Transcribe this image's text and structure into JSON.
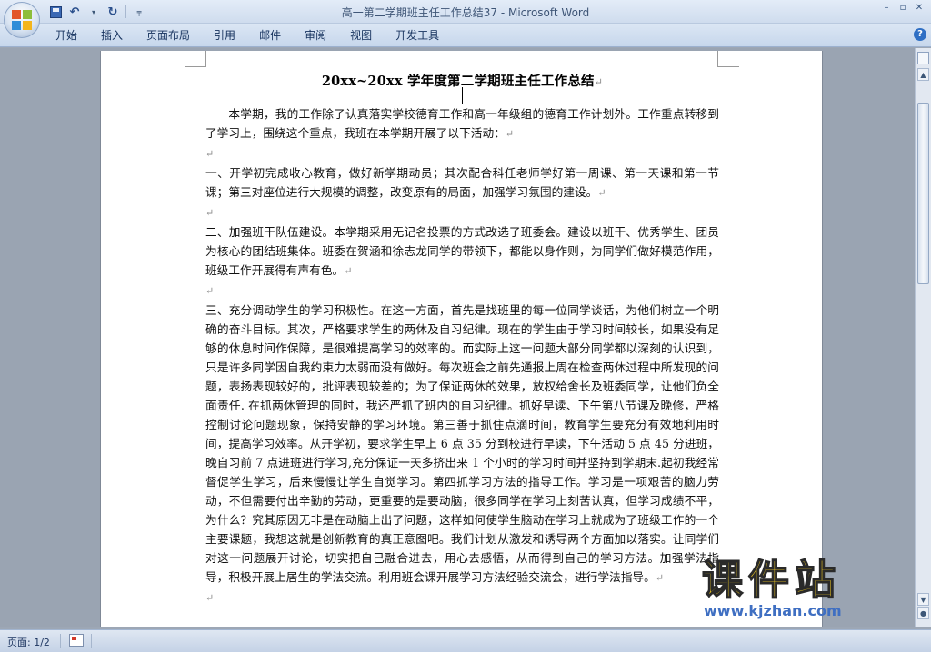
{
  "window": {
    "doc_name": "高一第二学期班主任工作总结37",
    "separator": " - ",
    "app_name": "Microsoft Word"
  },
  "quick_access": {
    "undo_glyph": "↶",
    "redo_glyph": "↻",
    "dropdown_glyph": "▾",
    "customize_glyph": "╤"
  },
  "window_controls": {
    "minimize": "–",
    "restore": "▫",
    "close": "✕"
  },
  "ribbon": {
    "tabs": [
      "开始",
      "插入",
      "页面布局",
      "引用",
      "邮件",
      "审阅",
      "视图",
      "开发工具"
    ],
    "help": "?"
  },
  "document": {
    "title": "20xx~20xx 学年度第二学期班主任工作总结",
    "paragraph_mark": "↵",
    "paragraphs": [
      "本学期，我的工作除了认真落实学校德育工作和高一年级组的德育工作计划外。工作重点转移到了学习上，围绕这个重点，我班在本学期开展了以下活动：",
      "",
      "一、开学初完成收心教育，做好新学期动员；其次配合科任老师学好第一周课、第一天课和第一节课；第三对座位进行大规模的调整，改变原有的局面，加强学习氛围的建设。",
      "",
      "二、加强班干队伍建设。本学期采用无记名投票的方式改选了班委会。建设以班干、优秀学生、团员为核心的团结班集体。班委在贺涵和徐志龙同学的带领下，都能以身作则，为同学们做好模范作用，班级工作开展得有声有色。",
      "",
      "三、充分调动学生的学习积极性。在这一方面，首先是找班里的每一位同学谈话，为他们树立一个明确的奋斗目标。其次，严格要求学生的两休及自习纪律。现在的学生由于学习时间较长，如果没有足够的休息时间作保障，是很难提高学习的效率的。而实际上这一问题大部分同学都以深刻的认识到，只是许多同学因自我约束力太弱而没有做好。每次班会之前先通报上周在检查两休过程中所发现的问题，表扬表现较好的，批评表现较差的；为了保证两休的效果，放权给舍长及班委同学，让他们负全面责任. 在抓两休管理的同时，我还严抓了班内的自习纪律。抓好早读、下午第八节课及晚修，严格控制讨论问题现象，保持安静的学习环境。第三善于抓住点滴时间，教育学生要充分有效地利用时间，提高学习效率。从开学初，要求学生早上 6 点 35 分到校进行早读，下午活动 5 点 45 分进班，晚自习前 7 点进班进行学习,充分保证一天多挤出来 1 个小时的学习时间并坚持到学期末.起初我经常督促学生学习，后来慢慢让学生自觉学习。第四抓学习方法的指导工作。学习是一项艰苦的脑力劳动，不但需要付出辛勤的劳动，更重要的是要动脑，很多同学在学习上刻苦认真，但学习成绩不平，为什么？究其原因无非是在动脑上出了问题，这样如何使学生脑动在学习上就成为了班级工作的一个主要课题，我想这就是创新教育的真正意图吧。我们计划从激发和诱导两个方面加以落实。让同学们对这一问题展开讨论，切实把自己融合进去，用心去感悟，从而得到自己的学习方法。加强学法指导，积极开展上居生的学法交流。利用班会课开展学习方法经验交流会，进行学法指导。",
      ""
    ]
  },
  "watermark": {
    "logo_text": "课件站",
    "url": "www.kjzhan.com"
  },
  "status_bar": {
    "page_info": "页面: 1/2"
  },
  "colors": {
    "ribbon_text": "#15315d",
    "watermark_yellow": "#f6ce21",
    "watermark_blue": "#3f6fc2"
  }
}
